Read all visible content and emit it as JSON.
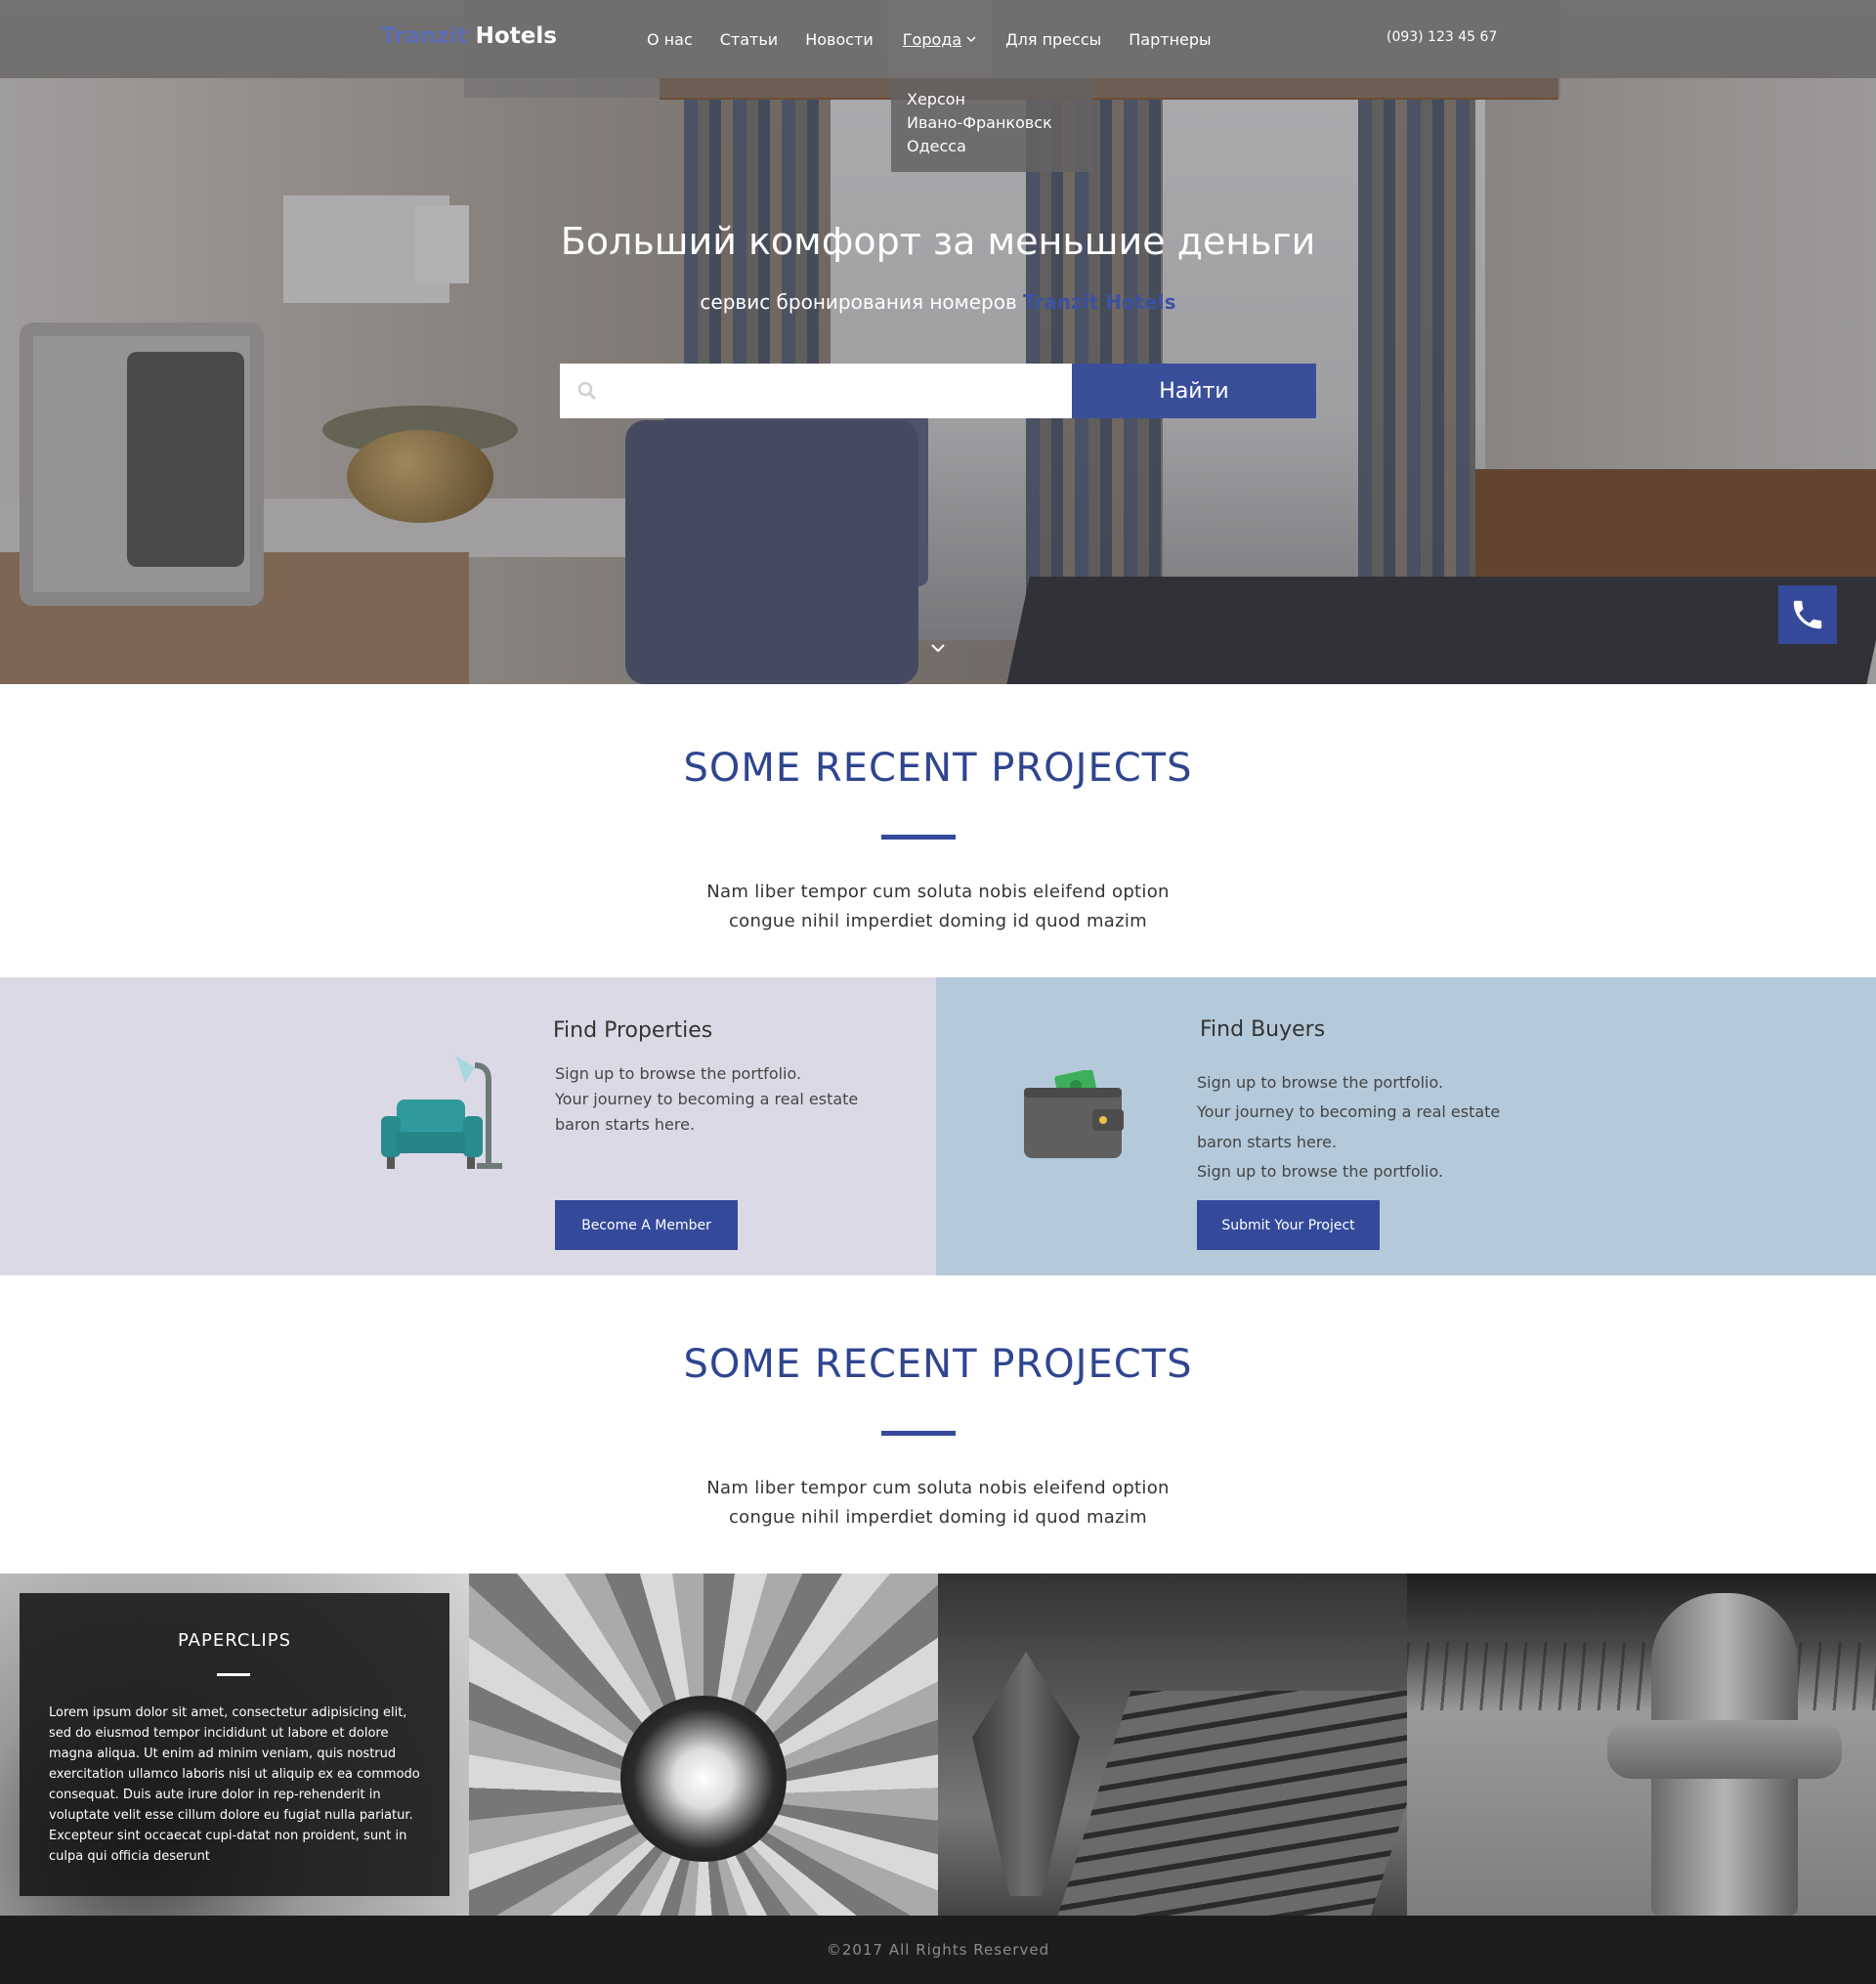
{
  "header": {
    "logo_part1": "Tranzit",
    "logo_part2": " Hotels",
    "phone": "(093) 123 45 67",
    "nav": [
      {
        "label": "О нас"
      },
      {
        "label": "Статьи"
      },
      {
        "label": "Новости"
      },
      {
        "label": "Города",
        "active": true
      },
      {
        "label": "Для прессы"
      },
      {
        "label": "Партнеры"
      }
    ],
    "dropdown": [
      "Херсон",
      "Ивано-Франковск",
      "Одесса"
    ]
  },
  "hero": {
    "title": "Больший комфорт за меньшие деньги",
    "subtitle": "сервис бронирования номеров",
    "subtitle_brand": "Tranzit Hotels",
    "search_value": "",
    "search_button": "Найти"
  },
  "section1": {
    "title": "SOME RECENT PROJECTS",
    "text_line1": "Nam liber tempor cum soluta nobis eleifend option",
    "text_line2": "congue nihil imperdiet doming id quod mazim"
  },
  "features": {
    "left": {
      "heading": "Find Properties",
      "lines": [
        "Sign up to browse the portfolio.",
        "Your journey to becoming a real estate",
        "baron starts here."
      ],
      "button": "Become A Member"
    },
    "right": {
      "heading": "Find Buyers",
      "lines": [
        "Sign up to browse the portfolio.",
        "Your journey to becoming a real estate",
        "baron starts here.",
        "Sign up to browse the portfolio."
      ],
      "button": "Submit Your Project"
    }
  },
  "section2": {
    "title": "SOME RECENT PROJECTS",
    "text_line1": "Nam liber tempor cum soluta nobis eleifend option",
    "text_line2": "congue nihil imperdiet doming id quod mazim"
  },
  "gallery": {
    "card_title": "PAPERCLIPS",
    "card_body": "Lorem ipsum dolor sit amet, consectetur adipisicing elit, sed do eiusmod tempor incididunt ut labore et dolore magna aliqua. Ut enim ad minim veniam, quis nostrud exercitation ullamco laboris nisi ut aliquip ex ea commodo consequat. Duis aute irure dolor in rep-rehenderit in voluptate velit esse cillum dolore eu fugiat nulla pariatur. Excepteur sint occaecat cupi-datat non proident, sunt in culpa qui officia deserunt"
  },
  "footer": {
    "text": "©2017 All Rights Reserved"
  },
  "colors": {
    "accent": "#34499a",
    "logo_accent": "#5b6db3",
    "feature_left_bg": "#dcd9e6",
    "feature_right_bg": "#b4cada",
    "footer_bg": "#1d1d1f"
  }
}
